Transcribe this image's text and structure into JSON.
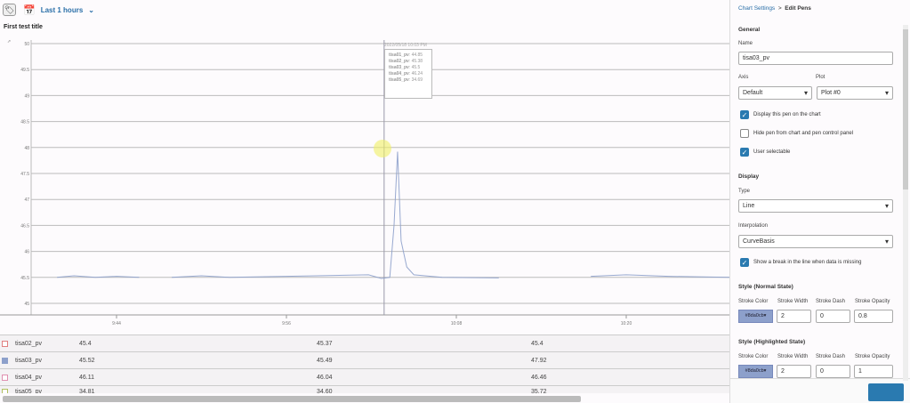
{
  "toolbar": {
    "time_range": "Last 1 hours"
  },
  "chart_title": "First test title",
  "chart_data": {
    "type": "line",
    "title": "First test title",
    "y_ticks": [
      "50",
      "49.5",
      "49",
      "48.5",
      "48",
      "47.5",
      "47",
      "46.5",
      "46",
      "45.5",
      "45"
    ],
    "ylim": [
      45,
      50
    ],
    "x_ticks": [
      {
        "label": "9:44",
        "min": 44
      },
      {
        "label": "9:56",
        "min": 56
      },
      {
        "label": "10:08",
        "min": 68
      },
      {
        "label": "10:20",
        "min": 80
      }
    ],
    "xlim_minutes_after_9": [
      38,
      87.3
    ],
    "series": [
      {
        "name": "tisa03_pv",
        "color": "#8da0cb",
        "segments": [
          [
            [
              39.8,
              45.5
            ],
            [
              41,
              45.53
            ],
            [
              42.5,
              45.5
            ],
            [
              44,
              45.52
            ],
            [
              45.6,
              45.5
            ]
          ],
          [
            [
              47.9,
              45.5
            ],
            [
              50,
              45.53
            ],
            [
              52,
              45.5
            ],
            [
              56,
              45.52
            ],
            [
              61.8,
              45.55
            ],
            [
              62.7,
              45.48
            ],
            [
              63.3,
              45.5
            ],
            [
              63.6,
              46.5
            ],
            [
              63.85,
              47.92
            ],
            [
              64.1,
              46.2
            ],
            [
              64.5,
              45.7
            ],
            [
              65,
              45.55
            ],
            [
              67,
              45.5
            ],
            [
              71,
              45.49
            ]
          ],
          [
            [
              77.5,
              45.52
            ],
            [
              80,
              45.55
            ],
            [
              83,
              45.52
            ],
            [
              87.3,
              45.5
            ]
          ]
        ]
      }
    ],
    "cursor_minutes": 62.9
  },
  "tooltip": {
    "date": "2022/05/18 10:03 PM",
    "items": [
      {
        "name": "tisa01_pv",
        "value": "44.85"
      },
      {
        "name": "tisa02_pv",
        "value": "45.38"
      },
      {
        "name": "tisa03_pv",
        "value": "45.5"
      },
      {
        "name": "tisa04_pv",
        "value": "46.24"
      },
      {
        "name": "tisa05_pv",
        "value": "34.69"
      }
    ]
  },
  "table": {
    "rows": [
      {
        "name": "tisa02_pv",
        "checked": false,
        "color": "#e08080",
        "v": [
          "45.4",
          "45.37",
          "45.4"
        ]
      },
      {
        "name": "tisa03_pv",
        "checked": true,
        "color": "#8da0cb",
        "v": [
          "45.52",
          "45.49",
          "47.92"
        ]
      },
      {
        "name": "tisa04_pv",
        "checked": false,
        "color": "#e090b0",
        "v": [
          "46.11",
          "46.04",
          "46.46"
        ]
      },
      {
        "name": "tisa05_pv",
        "checked": false,
        "color": "#b0c060",
        "v": [
          "34.81",
          "34.60",
          "35.72"
        ]
      }
    ]
  },
  "panel": {
    "breadcrumb": {
      "parent": "Chart Settings",
      "sep": ">",
      "current": "Edit Pens"
    },
    "general": "General",
    "name_label": "Name",
    "name_value": "tisa03_pv",
    "axis_label": "Axis",
    "axis_value": "Default",
    "plot_label": "Plot",
    "plot_value": "Plot #0",
    "display_on_chart": "Display this pen on the chart",
    "hide_pen": "Hide pen from chart and pen control panel",
    "user_selectable": "User selectable",
    "display": "Display",
    "type_label": "Type",
    "type_value": "Line",
    "interp_label": "Interpolation",
    "interp_value": "CurveBasis",
    "show_break": "Show a break in the line when data is missing",
    "normal": "Style (Normal State)",
    "highlighted": "Style (Highlighted State)",
    "stroke_color": "Stroke Color",
    "stroke_width": "Stroke Width",
    "stroke_dash": "Stroke Dash",
    "stroke_opacity": "Stroke Opacity",
    "normal_vals": {
      "color": "#8da0cb",
      "width": "2",
      "dash": "0",
      "opacity": "0.8"
    },
    "high_vals": {
      "color": "#8da0cb",
      "width": "2",
      "dash": "0",
      "opacity": "1"
    }
  }
}
